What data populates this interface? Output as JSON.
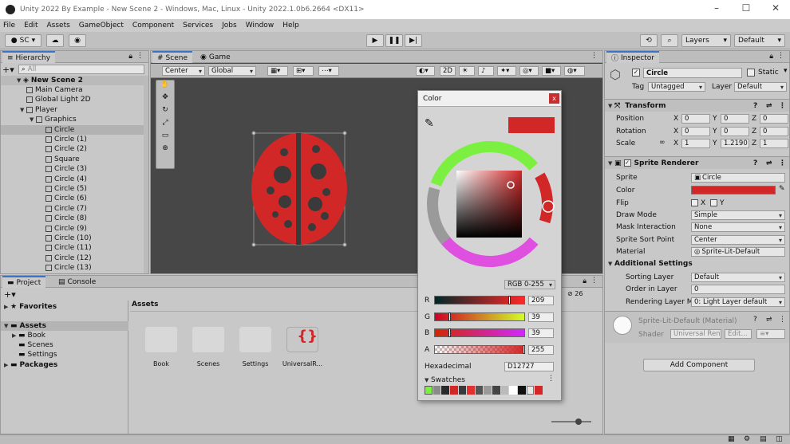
{
  "window": {
    "title": "Unity 2022 By Example - New Scene 2 - Windows, Mac, Linux - Unity 2022.1.0b6.2664 <DX11>"
  },
  "menu": [
    "File",
    "Edit",
    "Assets",
    "GameObject",
    "Component",
    "Services",
    "Jobs",
    "Window",
    "Help"
  ],
  "toolbar": {
    "account": "SC",
    "layers": "Layers",
    "layout": "Default"
  },
  "hierarchy": {
    "tab": "Hierarchy",
    "search_placeholder": "All",
    "scene": "New Scene 2",
    "items": [
      {
        "label": "Main Camera",
        "indent": 1
      },
      {
        "label": "Global Light 2D",
        "indent": 1
      },
      {
        "label": "Player",
        "indent": 1,
        "expanded": true
      },
      {
        "label": "Graphics",
        "indent": 2,
        "expanded": true
      },
      {
        "label": "Circle",
        "indent": 3,
        "selected": true
      },
      {
        "label": "Circle (1)",
        "indent": 3
      },
      {
        "label": "Circle (2)",
        "indent": 3
      },
      {
        "label": "Square",
        "indent": 3
      },
      {
        "label": "Circle (3)",
        "indent": 3
      },
      {
        "label": "Circle (4)",
        "indent": 3
      },
      {
        "label": "Circle (5)",
        "indent": 3
      },
      {
        "label": "Circle (6)",
        "indent": 3
      },
      {
        "label": "Circle (7)",
        "indent": 3
      },
      {
        "label": "Circle (8)",
        "indent": 3
      },
      {
        "label": "Circle (9)",
        "indent": 3
      },
      {
        "label": "Circle (10)",
        "indent": 3
      },
      {
        "label": "Circle (11)",
        "indent": 3
      },
      {
        "label": "Circle (12)",
        "indent": 3
      },
      {
        "label": "Circle (13)",
        "indent": 3
      }
    ]
  },
  "scene": {
    "tabs": [
      "Scene",
      "Game"
    ],
    "pivot": "Center",
    "space": "Global",
    "mode_2d": "2D"
  },
  "project": {
    "tabs": [
      "Project",
      "Console"
    ],
    "favorites": "Favorites",
    "assets_root": "Assets",
    "tree": [
      "Book",
      "Scenes",
      "Settings"
    ],
    "packages": "Packages",
    "breadcrumb": "Assets",
    "folders": [
      "Book",
      "Scenes",
      "Settings",
      "UniversalR..."
    ],
    "hidden_count": "26"
  },
  "inspector": {
    "tab": "Inspector",
    "object_name": "Circle",
    "static_label": "Static",
    "tag_label": "Tag",
    "tag_value": "Untagged",
    "layer_label": "Layer",
    "layer_value": "Default",
    "transform": {
      "header": "Transform",
      "position_label": "Position",
      "rotation_label": "Rotation",
      "scale_label": "Scale",
      "position": [
        "0",
        "0",
        "0"
      ],
      "rotation": [
        "0",
        "0",
        "0"
      ],
      "scale": [
        "1",
        "1.2190",
        "1"
      ]
    },
    "sprite_renderer": {
      "header": "Sprite Renderer",
      "sprite_label": "Sprite",
      "sprite_value": "Circle",
      "color_label": "Color",
      "flip_label": "Flip",
      "flip_x": "X",
      "flip_y": "Y",
      "draw_mode_label": "Draw Mode",
      "draw_mode": "Simple",
      "mask_label": "Mask Interaction",
      "mask": "None",
      "sort_point_label": "Sprite Sort Point",
      "sort_point": "Center",
      "material_label": "Material",
      "material": "Sprite-Lit-Default",
      "additional": "Additional Settings",
      "sorting_layer_label": "Sorting Layer",
      "sorting_layer": "Default",
      "order_label": "Order in Layer",
      "order": "0",
      "rendering_label": "Rendering Layer M",
      "rendering": "0: Light Layer default"
    },
    "material_block": {
      "name": "Sprite-Lit-Default (Material)",
      "shader_label": "Shader",
      "shader": "Universal Ren",
      "edit": "Edit..."
    },
    "add_component": "Add Component"
  },
  "color_picker": {
    "title": "Color",
    "mode": "RGB 0-255",
    "r_label": "R",
    "r": "209",
    "g_label": "G",
    "g": "39",
    "b_label": "B",
    "b": "39",
    "a_label": "A",
    "a": "255",
    "hex_label": "Hexadecimal",
    "hex": "D12727",
    "swatches_label": "Swatches",
    "color_hex": "#d12727"
  },
  "colors": {
    "accent": "#3a73c8",
    "ladybug_red": "#d12727",
    "scene_bg": "#474747"
  }
}
